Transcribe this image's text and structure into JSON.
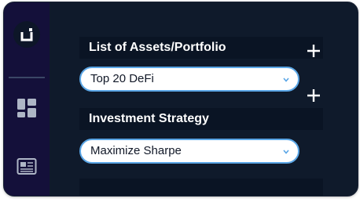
{
  "sidebar": {
    "logo": "app-logo",
    "items": [
      {
        "icon": "dashboard-icon"
      },
      {
        "icon": "newspaper-icon"
      }
    ]
  },
  "assets_section": {
    "title": "List of Assets/Portfolio",
    "selected": "Top 20 DeFi",
    "add_icon": "plus-icon"
  },
  "strategy_section": {
    "title": "Investment Strategy",
    "selected": "Maximize Sharpe",
    "add_icon": "plus-icon"
  },
  "colors": {
    "background": "#0f1a2b",
    "sidebar": "#14103a",
    "header": "#0a1424",
    "select_border": "#5aa6e6",
    "text_light": "#ffffff"
  }
}
